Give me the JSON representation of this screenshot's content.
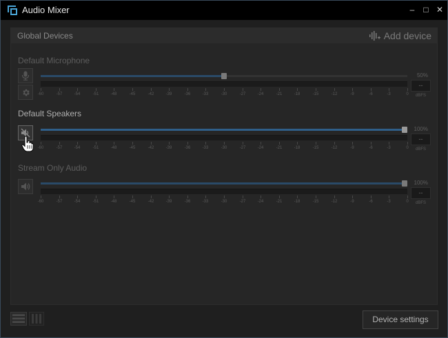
{
  "window": {
    "title": "Audio Mixer",
    "minimize_glyph": "–",
    "maximize_glyph": "□",
    "close_glyph": "✕",
    "app_icon": "streamlabs-logo-icon"
  },
  "panel": {
    "header_title": "Global Devices",
    "add_device_label": "Add device",
    "add_device_icon": "audio-wave-plus-icon"
  },
  "meter_scale": {
    "tick_labels": [
      "-60",
      "-57",
      "-54",
      "-51",
      "-48",
      "-45",
      "-42",
      "-39",
      "-36",
      "-33",
      "-30",
      "-27",
      "-24",
      "-21",
      "-18",
      "-15",
      "-12",
      "-9",
      "-6",
      "-3",
      "0"
    ],
    "unit": "dBFS"
  },
  "devices": [
    {
      "name": "Default Microphone",
      "volume_fraction": 0.5,
      "volume_label": "50%",
      "level_value": "--",
      "enabled": false,
      "icons": [
        "microphone-icon",
        "gear-icon"
      ]
    },
    {
      "name": "Default Speakers",
      "volume_fraction": 1.0,
      "volume_label": "100%",
      "level_value": "--",
      "enabled": true,
      "icons": [
        "speaker-muted-icon"
      ]
    },
    {
      "name": "Stream Only Audio",
      "volume_fraction": 1.0,
      "volume_label": "100%",
      "level_value": "--",
      "enabled": false,
      "icons": [
        "speaker-icon"
      ]
    }
  ],
  "footer": {
    "device_settings_label": "Device settings",
    "left_icons": [
      "horizontal-layout-icon",
      "vertical-layout-icon"
    ]
  },
  "colors": {
    "slider_fill": "#2f5f8a",
    "panel_bg": "#262626",
    "title_bg": "#000000"
  }
}
